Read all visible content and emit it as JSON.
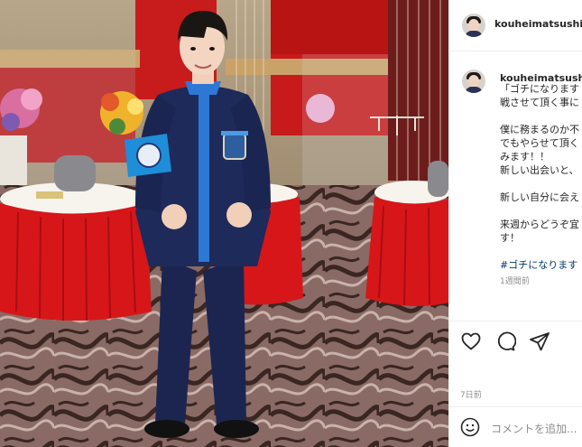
{
  "post": {
    "username": "kouheimatsushita",
    "caption_lines": [
      "「ゴチになります",
      "戦させて頂く事に",
      "",
      "僕に務まるのか不",
      "でもやらせて頂く",
      "みます！！",
      "新しい出会いと、",
      "",
      "新しい自分に会え",
      "",
      "来週からどうぞ宜",
      "す！"
    ],
    "hashtag": "#ゴチになります",
    "comment_time": "1週間前",
    "post_date": "7日前",
    "comment_placeholder": "コメントを追加..."
  },
  "icons": {
    "like": "heart-icon",
    "comment": "comment-bubble-icon",
    "share": "paper-plane-icon",
    "emoji": "smiley-emoji-icon"
  },
  "colors": {
    "text": "#262626",
    "muted": "#8e8e8e",
    "hashtag": "#00376b",
    "divider": "#efefef"
  }
}
